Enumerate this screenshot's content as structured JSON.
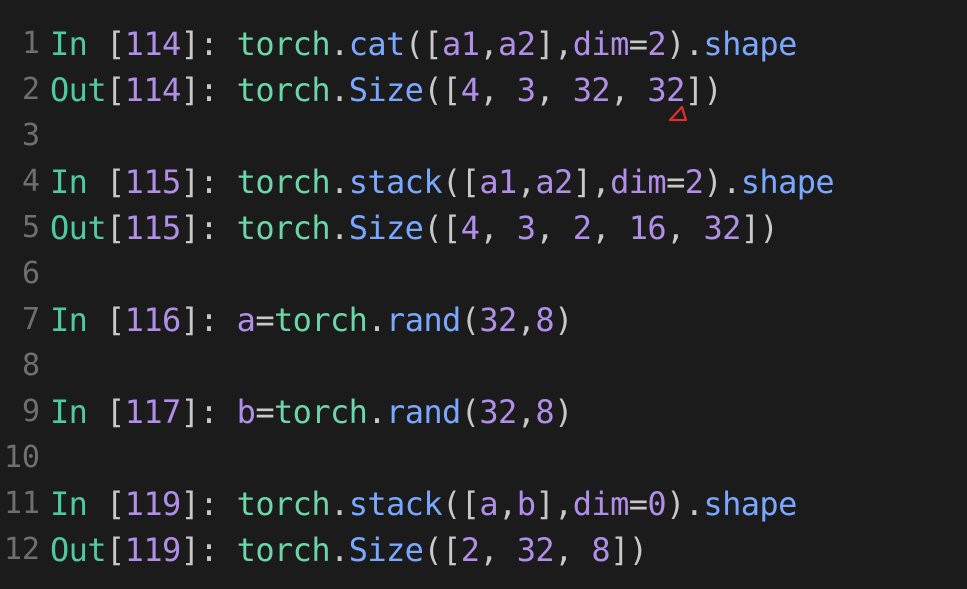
{
  "colors": {
    "background": "#1b1b1b",
    "line_number": "#6f6f6f",
    "prompt_green": "#4ec9a0",
    "torch_green": "#6bd6a6",
    "purple": "#b18ee8",
    "punct": "#c8c8c8",
    "method_blue": "#7aa8ff",
    "marker_red": "#e0302a"
  },
  "lines": [
    {
      "num": "1",
      "tokens": [
        {
          "t": "In ",
          "c": "prompt_green"
        },
        {
          "t": "[",
          "c": "punct"
        },
        {
          "t": "114",
          "c": "purple"
        },
        {
          "t": "]: ",
          "c": "punct"
        },
        {
          "t": "torch",
          "c": "torch_green"
        },
        {
          "t": ".",
          "c": "punct"
        },
        {
          "t": "cat",
          "c": "method_blue"
        },
        {
          "t": "([",
          "c": "punct"
        },
        {
          "t": "a1",
          "c": "purple"
        },
        {
          "t": ",",
          "c": "punct"
        },
        {
          "t": "a2",
          "c": "purple"
        },
        {
          "t": "],",
          "c": "punct"
        },
        {
          "t": "dim",
          "c": "purple"
        },
        {
          "t": "=",
          "c": "punct"
        },
        {
          "t": "2",
          "c": "purple"
        },
        {
          "t": ").",
          "c": "punct"
        },
        {
          "t": "shape",
          "c": "method_blue"
        }
      ]
    },
    {
      "num": "2",
      "tokens": [
        {
          "t": "Out",
          "c": "prompt_green"
        },
        {
          "t": "[",
          "c": "punct"
        },
        {
          "t": "114",
          "c": "purple"
        },
        {
          "t": "]: ",
          "c": "punct"
        },
        {
          "t": "torch",
          "c": "torch_green"
        },
        {
          "t": ".",
          "c": "punct"
        },
        {
          "t": "Size",
          "c": "method_blue"
        },
        {
          "t": "([",
          "c": "punct"
        },
        {
          "t": "4",
          "c": "purple"
        },
        {
          "t": ", ",
          "c": "punct"
        },
        {
          "t": "3",
          "c": "purple"
        },
        {
          "t": ", ",
          "c": "punct"
        },
        {
          "t": "32",
          "c": "purple"
        },
        {
          "t": ", ",
          "c": "punct"
        },
        {
          "t": "32",
          "c": "purple"
        },
        {
          "t": "])",
          "c": "punct"
        }
      ]
    },
    {
      "num": "3",
      "tokens": []
    },
    {
      "num": "4",
      "tokens": [
        {
          "t": "In ",
          "c": "prompt_green"
        },
        {
          "t": "[",
          "c": "punct"
        },
        {
          "t": "115",
          "c": "purple"
        },
        {
          "t": "]: ",
          "c": "punct"
        },
        {
          "t": "torch",
          "c": "torch_green"
        },
        {
          "t": ".",
          "c": "punct"
        },
        {
          "t": "stack",
          "c": "method_blue"
        },
        {
          "t": "([",
          "c": "punct"
        },
        {
          "t": "a1",
          "c": "purple"
        },
        {
          "t": ",",
          "c": "punct"
        },
        {
          "t": "a2",
          "c": "purple"
        },
        {
          "t": "],",
          "c": "punct"
        },
        {
          "t": "dim",
          "c": "purple"
        },
        {
          "t": "=",
          "c": "punct"
        },
        {
          "t": "2",
          "c": "purple"
        },
        {
          "t": ").",
          "c": "punct"
        },
        {
          "t": "shape",
          "c": "method_blue"
        }
      ]
    },
    {
      "num": "5",
      "tokens": [
        {
          "t": "Out",
          "c": "prompt_green"
        },
        {
          "t": "[",
          "c": "punct"
        },
        {
          "t": "115",
          "c": "purple"
        },
        {
          "t": "]: ",
          "c": "punct"
        },
        {
          "t": "torch",
          "c": "torch_green"
        },
        {
          "t": ".",
          "c": "punct"
        },
        {
          "t": "Size",
          "c": "method_blue"
        },
        {
          "t": "([",
          "c": "punct"
        },
        {
          "t": "4",
          "c": "purple"
        },
        {
          "t": ", ",
          "c": "punct"
        },
        {
          "t": "3",
          "c": "purple"
        },
        {
          "t": ", ",
          "c": "punct"
        },
        {
          "t": "2",
          "c": "purple"
        },
        {
          "t": ", ",
          "c": "punct"
        },
        {
          "t": "16",
          "c": "purple"
        },
        {
          "t": ", ",
          "c": "punct"
        },
        {
          "t": "32",
          "c": "purple"
        },
        {
          "t": "])",
          "c": "punct"
        }
      ]
    },
    {
      "num": "6",
      "tokens": []
    },
    {
      "num": "7",
      "tokens": [
        {
          "t": "In ",
          "c": "prompt_green"
        },
        {
          "t": "[",
          "c": "punct"
        },
        {
          "t": "116",
          "c": "purple"
        },
        {
          "t": "]: ",
          "c": "punct"
        },
        {
          "t": "a",
          "c": "purple"
        },
        {
          "t": "=",
          "c": "punct"
        },
        {
          "t": "torch",
          "c": "torch_green"
        },
        {
          "t": ".",
          "c": "punct"
        },
        {
          "t": "rand",
          "c": "method_blue"
        },
        {
          "t": "(",
          "c": "punct"
        },
        {
          "t": "32",
          "c": "purple"
        },
        {
          "t": ",",
          "c": "punct"
        },
        {
          "t": "8",
          "c": "purple"
        },
        {
          "t": ")",
          "c": "punct"
        }
      ]
    },
    {
      "num": "8",
      "tokens": []
    },
    {
      "num": "9",
      "tokens": [
        {
          "t": "In ",
          "c": "prompt_green"
        },
        {
          "t": "[",
          "c": "punct"
        },
        {
          "t": "117",
          "c": "purple"
        },
        {
          "t": "]: ",
          "c": "punct"
        },
        {
          "t": "b",
          "c": "purple"
        },
        {
          "t": "=",
          "c": "punct"
        },
        {
          "t": "torch",
          "c": "torch_green"
        },
        {
          "t": ".",
          "c": "punct"
        },
        {
          "t": "rand",
          "c": "method_blue"
        },
        {
          "t": "(",
          "c": "punct"
        },
        {
          "t": "32",
          "c": "purple"
        },
        {
          "t": ",",
          "c": "punct"
        },
        {
          "t": "8",
          "c": "purple"
        },
        {
          "t": ")",
          "c": "punct"
        }
      ]
    },
    {
      "num": "10",
      "tokens": []
    },
    {
      "num": "11",
      "tokens": [
        {
          "t": "In ",
          "c": "prompt_green"
        },
        {
          "t": "[",
          "c": "punct"
        },
        {
          "t": "119",
          "c": "purple"
        },
        {
          "t": "]: ",
          "c": "punct"
        },
        {
          "t": "torch",
          "c": "torch_green"
        },
        {
          "t": ".",
          "c": "punct"
        },
        {
          "t": "stack",
          "c": "method_blue"
        },
        {
          "t": "([",
          "c": "punct"
        },
        {
          "t": "a",
          "c": "purple"
        },
        {
          "t": ",",
          "c": "punct"
        },
        {
          "t": "b",
          "c": "purple"
        },
        {
          "t": "],",
          "c": "punct"
        },
        {
          "t": "dim",
          "c": "purple"
        },
        {
          "t": "=",
          "c": "punct"
        },
        {
          "t": "0",
          "c": "purple"
        },
        {
          "t": ").",
          "c": "punct"
        },
        {
          "t": "shape",
          "c": "method_blue"
        }
      ]
    },
    {
      "num": "12",
      "tokens": [
        {
          "t": "Out",
          "c": "prompt_green"
        },
        {
          "t": "[",
          "c": "punct"
        },
        {
          "t": "119",
          "c": "purple"
        },
        {
          "t": "]: ",
          "c": "punct"
        },
        {
          "t": "torch",
          "c": "torch_green"
        },
        {
          "t": ".",
          "c": "punct"
        },
        {
          "t": "Size",
          "c": "method_blue"
        },
        {
          "t": "([",
          "c": "punct"
        },
        {
          "t": "2",
          "c": "purple"
        },
        {
          "t": ", ",
          "c": "punct"
        },
        {
          "t": "32",
          "c": "purple"
        },
        {
          "t": ", ",
          "c": "punct"
        },
        {
          "t": "8",
          "c": "purple"
        },
        {
          "t": "])",
          "c": "punct"
        }
      ]
    }
  ],
  "annotation": {
    "icon": "red-triangle-marker-icon"
  }
}
